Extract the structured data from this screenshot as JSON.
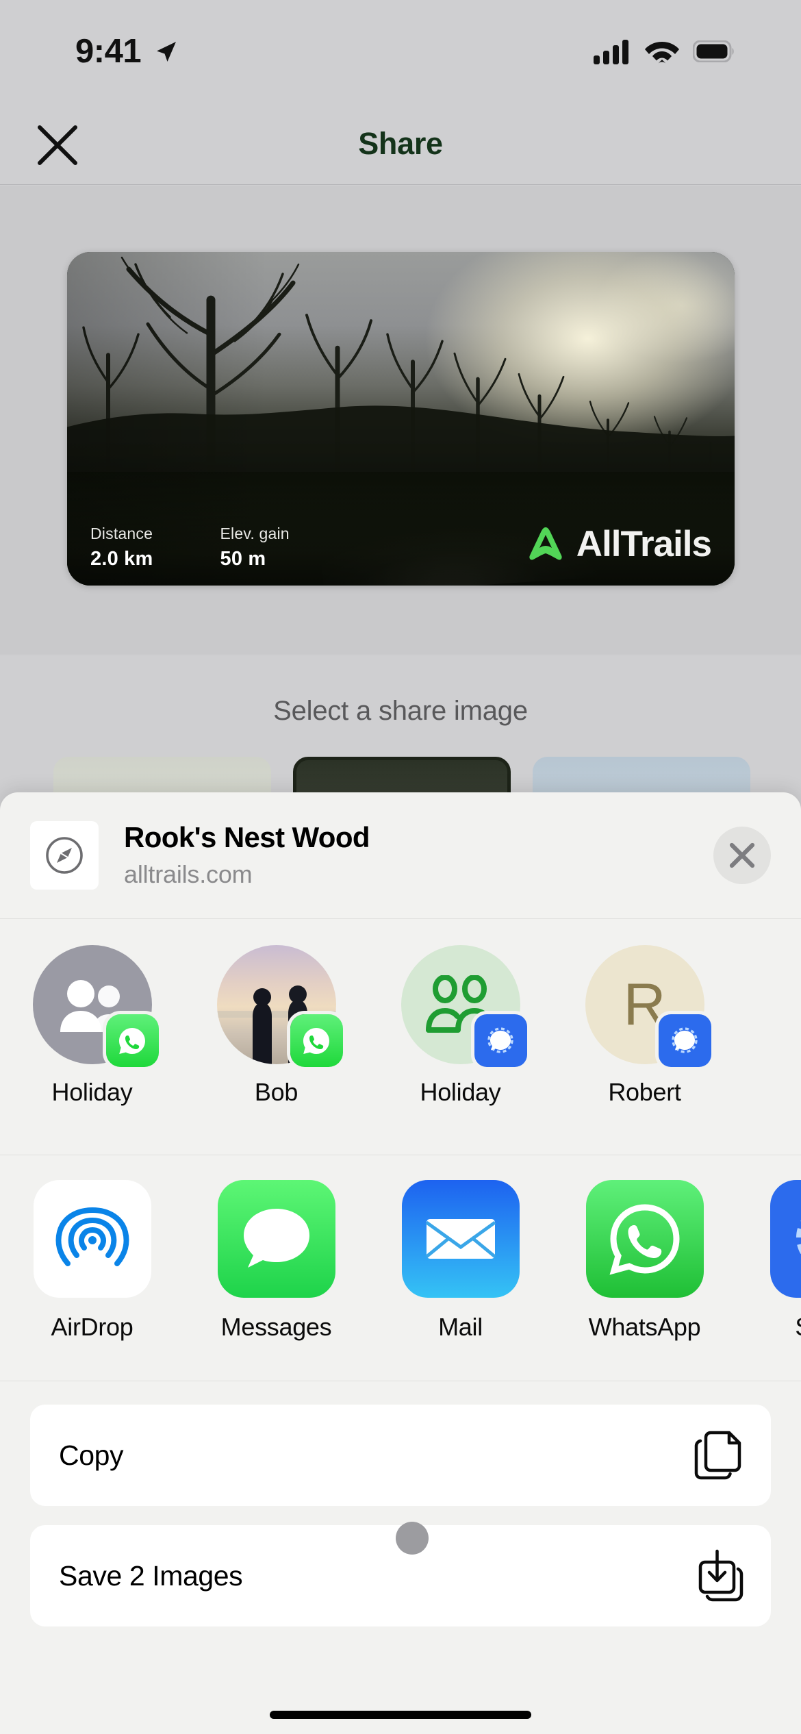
{
  "status_bar": {
    "time": "9:41",
    "location_icon": "location-arrow-icon",
    "cellular_icon": "cellular-signal-icon",
    "wifi_icon": "wifi-icon",
    "battery_icon": "battery-full-icon"
  },
  "nav": {
    "title": "Share",
    "close_icon": "close-x-icon"
  },
  "share_card": {
    "stats": [
      {
        "label": "Distance",
        "value": "2.0 km"
      },
      {
        "label": "Elev. gain",
        "value": "50 m"
      }
    ],
    "brand_name": "AllTrails",
    "brand_icon": "alltrails-mountain-icon",
    "brand_color": "#52d557"
  },
  "picker": {
    "label": "Select a share image",
    "thumbnails": [
      {
        "name": "map-thumbnail",
        "selected": false
      },
      {
        "name": "photo-thumbnail",
        "selected": true
      },
      {
        "name": "elevation-thumbnail",
        "selected": false
      }
    ]
  },
  "share_sheet": {
    "header": {
      "title": "Rook's Nest Wood",
      "subtitle": "alltrails.com",
      "preview_icon": "safari-compass-icon",
      "close_icon": "close-x-icon"
    },
    "contacts": [
      {
        "name": "Holiday",
        "avatar_type": "group-gray",
        "app_badge": "whatsapp-badge-icon"
      },
      {
        "name": "Bob",
        "avatar_type": "photo",
        "app_badge": "whatsapp-badge-icon"
      },
      {
        "name": "Holiday",
        "avatar_type": "group-green",
        "app_badge": "signal-badge-icon"
      },
      {
        "name": "Robert",
        "avatar_type": "initial",
        "initial": "R",
        "app_badge": "signal-badge-icon"
      }
    ],
    "apps": [
      {
        "name": "AirDrop",
        "icon": "airdrop-icon"
      },
      {
        "name": "Messages",
        "icon": "messages-icon"
      },
      {
        "name": "Mail",
        "icon": "mail-icon"
      },
      {
        "name": "WhatsApp",
        "icon": "whatsapp-icon"
      },
      {
        "name": "Signal",
        "icon": "signal-icon"
      }
    ],
    "actions": [
      {
        "label": "Copy",
        "icon": "copy-documents-icon"
      },
      {
        "label": "Save 2 Images",
        "icon": "save-images-icon"
      }
    ]
  }
}
